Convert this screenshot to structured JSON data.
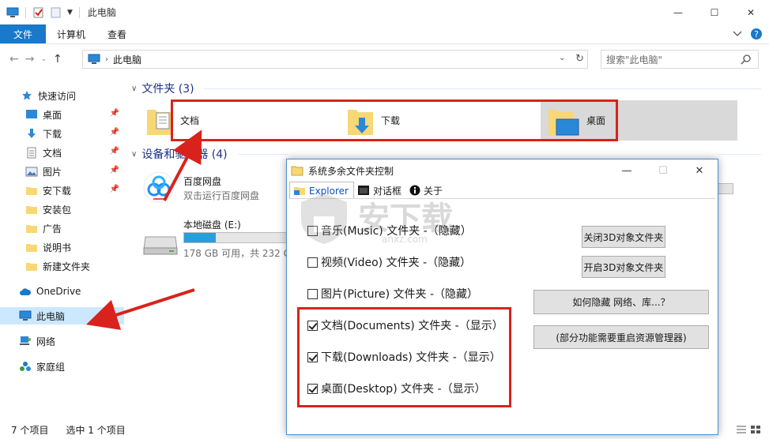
{
  "window": {
    "title": "此电脑",
    "controls": {
      "minimize": "—",
      "maximize": "☐",
      "close": "✕"
    }
  },
  "ribbon": {
    "tabs": [
      {
        "label": "文件",
        "active": true
      },
      {
        "label": "计算机"
      },
      {
        "label": "查看"
      }
    ],
    "expand_icon": "chevron-down-icon",
    "help_icon": "help-icon"
  },
  "address": {
    "path": "此电脑",
    "search_placeholder": "搜索\"此电脑\""
  },
  "sidebar": {
    "items": [
      {
        "label": "快速访问",
        "icon": "star-icon"
      },
      {
        "label": "桌面",
        "icon": "desktop-icon",
        "pinned": true
      },
      {
        "label": "下载",
        "icon": "download-icon",
        "pinned": true
      },
      {
        "label": "文档",
        "icon": "document-icon",
        "pinned": true
      },
      {
        "label": "图片",
        "icon": "picture-icon",
        "pinned": true
      },
      {
        "label": "安下载",
        "icon": "folder-icon",
        "pinned": true
      },
      {
        "label": "安装包",
        "icon": "folder-icon"
      },
      {
        "label": "广告",
        "icon": "folder-icon"
      },
      {
        "label": "说明书",
        "icon": "folder-icon"
      },
      {
        "label": "新建文件夹",
        "icon": "folder-icon"
      },
      {
        "label": "OneDrive",
        "icon": "cloud-icon"
      },
      {
        "label": "此电脑",
        "icon": "pc-icon",
        "selected": true
      },
      {
        "label": "网络",
        "icon": "network-icon"
      },
      {
        "label": "家庭组",
        "icon": "homegroup-icon"
      }
    ]
  },
  "content": {
    "folders_header": "文件夹 (3)",
    "folders": [
      {
        "label": "文档",
        "icon": "documents-folder-icon"
      },
      {
        "label": "下载",
        "icon": "downloads-folder-icon"
      },
      {
        "label": "桌面",
        "icon": "desktop-folder-icon",
        "selected": true
      }
    ],
    "devices_header": "设备和驱动器 (4)",
    "drives": [
      {
        "name": "百度网盘",
        "sub": "双击运行百度网盘",
        "icon": "baidu-netdisk-icon"
      },
      {
        "name": "本地磁盘 (E:)",
        "sub": "178 GB 可用，共 232 G",
        "icon": "hard-drive-icon",
        "used_fraction": 0.23
      }
    ]
  },
  "status": {
    "count": "7 个项目",
    "selected": "选中 1 个项目"
  },
  "dialog": {
    "title": "系统多余文件夹控制",
    "tabs": [
      {
        "label": "Explorer",
        "active": true,
        "icon": "explorer-folder-icon"
      },
      {
        "label": "对话框",
        "icon": "dialog-icon"
      },
      {
        "label": "关于",
        "icon": "info-icon"
      }
    ],
    "options": [
      {
        "label": "音乐(Music) 文件夹 -（隐藏）",
        "checked": false
      },
      {
        "label": "视频(Video) 文件夹 -（隐藏）",
        "checked": false
      },
      {
        "label": "图片(Picture) 文件夹 -（隐藏）",
        "checked": false
      },
      {
        "label": "文档(Documents) 文件夹 -（显示）",
        "checked": true
      },
      {
        "label": "下载(Downloads) 文件夹 -（显示）",
        "checked": true
      },
      {
        "label": "桌面(Desktop) 文件夹 -（显示）",
        "checked": true
      }
    ],
    "buttons": {
      "close_3d": "关闭3D对象文件夹",
      "open_3d": "开启3D对象文件夹",
      "how_hide": "如何隐藏 网络、库...？",
      "restart_note": "(部分功能需要重启资源管理器)"
    }
  },
  "watermark": {
    "text": "安下载",
    "sub": "anxz.com"
  },
  "colors": {
    "accent": "#1979ca",
    "highlight": "#d9221c",
    "selection": "#cce8ff",
    "folder": "#f8d775",
    "group_header": "#1e3287"
  }
}
